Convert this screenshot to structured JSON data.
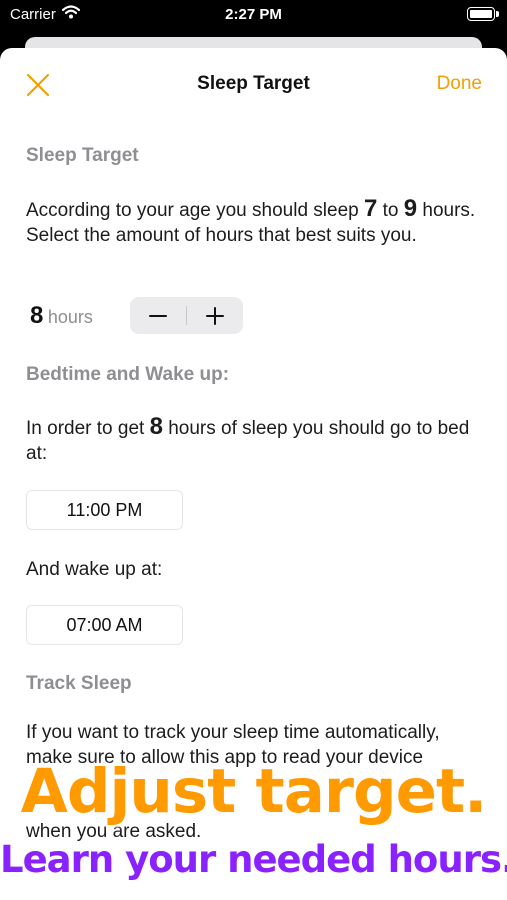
{
  "status_bar": {
    "carrier": "Carrier",
    "time": "2:27 PM"
  },
  "nav": {
    "title": "Sleep Target",
    "done_label": "Done"
  },
  "sleep_target": {
    "section_title": "Sleep Target",
    "text_before": "According to your age you should sleep ",
    "min_hours": "7",
    "text_to": " to ",
    "max_hours": "9",
    "text_after": " hours. Select the amount of hours that best suits you.",
    "hours_value": "8",
    "hours_unit": "hours"
  },
  "bedtime": {
    "section_title": "Bedtime and Wake up:",
    "text_before": "In order to get ",
    "hours": "8",
    "text_after": " hours of sleep you should go to bed at:",
    "bed_time": "11:00 PM",
    "wake_label": "And wake up at:",
    "wake_time": "07:00 AM"
  },
  "track": {
    "section_title": "Track Sleep",
    "line1": "If you want to track your sleep time automatically,",
    "line2": "make sure to allow this app to read your device",
    "line4": "when you are asked."
  },
  "promo": {
    "headline": "Adjust target.",
    "subline": "Learn your needed hours."
  },
  "colors": {
    "accent": "#f2a100",
    "headline": "#ff9a00",
    "subline": "#8a22ff"
  }
}
